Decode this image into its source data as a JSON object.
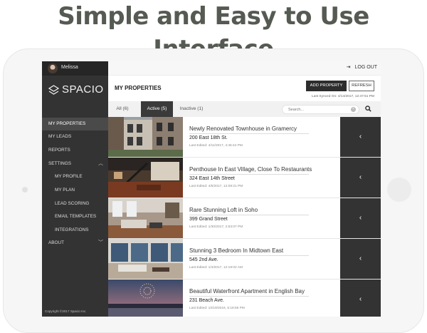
{
  "headline": "Simple and Easy to Use Interface",
  "user": {
    "name": "Melissa"
  },
  "brand": {
    "name": "SPACIO"
  },
  "header": {
    "logout_label": "LOG OUT",
    "page_title": "MY PROPERTIES",
    "add_property_label": "ADD PROPERTY",
    "refresh_label": "REFRESH",
    "last_synced": "Last Synced On: 4/14/2017, 12:47:51 PM"
  },
  "sidebar": {
    "items": [
      {
        "label": "MY PROPERTIES",
        "active": true
      },
      {
        "label": "MY LEADS"
      },
      {
        "label": "REPORTS"
      },
      {
        "label": "SETTINGS",
        "expanded": true
      },
      {
        "label": "MY PROFILE"
      },
      {
        "label": "MY PLAN"
      },
      {
        "label": "LEAD SCORING"
      },
      {
        "label": "EMAIL TEMPLATES"
      },
      {
        "label": "INTEGRATIONS"
      },
      {
        "label": "ABOUT"
      }
    ],
    "copyright": "Copyright ©2017 Spacio Inc."
  },
  "tabs": [
    {
      "label": "All (6)"
    },
    {
      "label": "Active (5)",
      "active": true
    },
    {
      "label": "Inactive (1)"
    }
  ],
  "search": {
    "placeholder": "Search..."
  },
  "properties": [
    {
      "title": "Newly Renovated Townhouse in Gramercy",
      "address": "200 East 18th St.",
      "edited": "Last Edited: 4/11/2017, 4:45:44 PM"
    },
    {
      "title": "Penthouse In East Village, Close To Restaurants",
      "address": "324 East 14th Street",
      "edited": "Last Edited: 4/5/2017, 12:08:21 PM"
    },
    {
      "title": "Rare Stunning Loft in Soho",
      "address": "399 Grand Street",
      "edited": "Last Edited: 1/30/2017, 2:53:07 PM"
    },
    {
      "title": "Stunning 3 Bedroom In Midtown East",
      "address": "545 2nd Ave.",
      "edited": "Last Edited: 1/4/2017, 12:19:02 AM"
    },
    {
      "title": "Beautiful Waterfront Apartment in English Bay",
      "address": "231 Beach Ave.",
      "edited": "Last Edited: 10/19/2016, 5:18:56 PM"
    }
  ],
  "icons": {
    "row_action": "chevron-left-icon",
    "search": "search-icon",
    "clear": "clear-icon",
    "logout": "logout-icon"
  },
  "colors": {
    "sidebar": "#333333",
    "row_action": "#333333",
    "headline": "#555a52"
  }
}
